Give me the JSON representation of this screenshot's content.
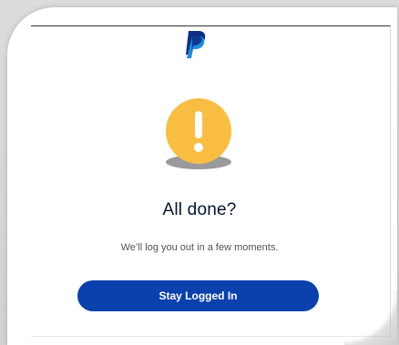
{
  "dialog": {
    "title": "All done?",
    "message": "We’ll log you out in a few moments.",
    "primary_button": "Stay Logged In"
  },
  "icons": {
    "logo": "paypal-logo-icon",
    "warning": "warning-exclamation-icon"
  },
  "colors": {
    "button_bg": "#0a41ad",
    "warning_circle": "#f9be41",
    "warning_shadow": "#9a9a9a",
    "logo_dark": "#0a2f86",
    "logo_light": "#1f8de2",
    "title_text": "#001435"
  }
}
